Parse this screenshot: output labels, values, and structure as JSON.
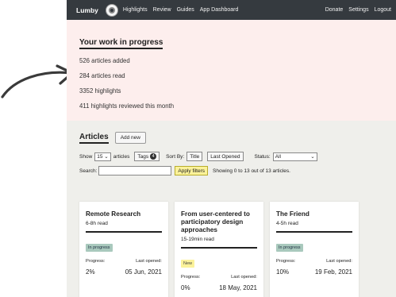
{
  "header": {
    "brand": "Lumby",
    "nav": [
      "Highlights",
      "Review",
      "Guides",
      "App Dashboard"
    ],
    "nav_right": [
      "Donate",
      "Settings",
      "Logout"
    ]
  },
  "progress": {
    "title": "Your work in progress",
    "stats": [
      "526 articles added",
      "284 articles read",
      "3352 highlights",
      "411 highlights reviewed this month"
    ]
  },
  "articles": {
    "title": "Articles",
    "add_new": "Add new",
    "show_label": "Show",
    "show_value": "15",
    "articles_label": "articles",
    "tags_label": "Tags",
    "tags_count": "4",
    "sort_by_label": "Sort By:",
    "sort_title": "Title",
    "sort_last_opened": "Last Opened",
    "status_label": "Status:",
    "status_value": "All",
    "search_label": "Search:",
    "search_value": "",
    "apply_filters": "Apply filters",
    "showing_text": "Showing 0 to 13 out of 13 articles."
  },
  "cards": [
    {
      "title": "Remote Research",
      "read_time": "6-8h read",
      "status": "In progress",
      "progress_label": "Progress:",
      "last_opened_label": "Last opened:",
      "progress": "2%",
      "last_opened": "05 Jun, 2021"
    },
    {
      "title": "From user-centered to participatory design approaches",
      "read_time": "15-19min read",
      "status": "New",
      "progress_label": "Progress:",
      "last_opened_label": "Last opened:",
      "progress": "0%",
      "last_opened": "18 May, 2021"
    },
    {
      "title": "The Friend",
      "read_time": "4-5h read",
      "status": "In progress",
      "progress_label": "Progress:",
      "last_opened_label": "Last opened:",
      "progress": "10%",
      "last_opened": "19 Feb, 2021"
    }
  ],
  "colors": {
    "topbar": "#353a3f",
    "progress_panel": "#fdeeed",
    "in_progress_pill": "#a9c9bd",
    "new_pill": "#fbf29a"
  }
}
